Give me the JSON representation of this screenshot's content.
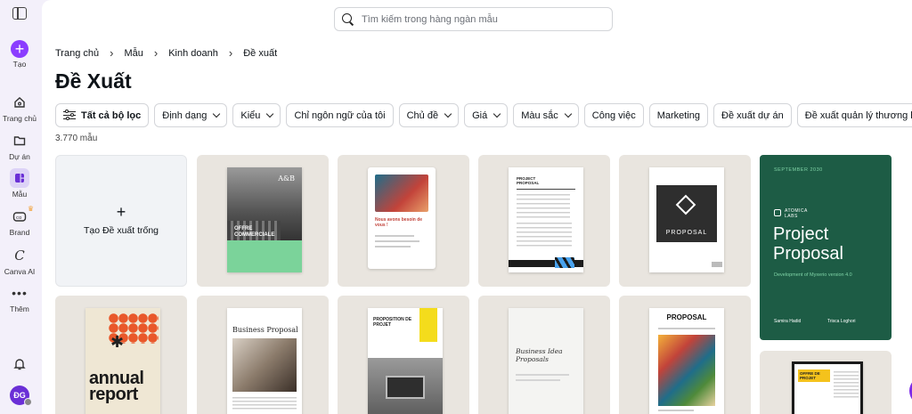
{
  "sidebar": {
    "create_label": "Tạo",
    "items": [
      {
        "label": "Trang chủ",
        "icon": "home-icon"
      },
      {
        "label": "Dự án",
        "icon": "folder-icon"
      },
      {
        "label": "Mẫu",
        "icon": "template-icon"
      },
      {
        "label": "Brand",
        "icon": "brand-icon"
      },
      {
        "label": "Canva AI",
        "icon": "canva-ai-icon"
      },
      {
        "label": "Thêm",
        "icon": "more-icon"
      }
    ],
    "avatar_initials": "ĐG"
  },
  "search": {
    "placeholder": "Tìm kiếm trong hàng ngàn mẫu"
  },
  "breadcrumb": [
    "Trang chủ",
    "Mẫu",
    "Kinh doanh",
    "Đề xuất"
  ],
  "page_title": "Đề Xuất",
  "filters": {
    "all_filters": "Tất cả bộ lọc",
    "dropdowns": [
      "Định dạng",
      "Kiểu"
    ],
    "language": "Chỉ ngôn ngữ của tôi",
    "dropdowns2": [
      "Chủ đề",
      "Giá",
      "Màu sắc"
    ],
    "tags": [
      "Công việc",
      "Marketing",
      "Đề xuất dự án",
      "Đề xuất quản lý thương hiệu"
    ]
  },
  "result_count": "3.770 mẫu",
  "blank_card_label": "Tạo Đề xuất trống",
  "templates": {
    "offre": {
      "brand": "A&B",
      "title": "OFFRE COMMERCIALE"
    },
    "nous": {
      "title": "Nous avons besoin de vous !"
    },
    "project_small": {
      "title": "PROJECT PROPOSAL"
    },
    "proposal_dark": {
      "title": "PROPOSAL"
    },
    "atomica": {
      "date": "SEPTEMBER 2030",
      "company": "ATOMICA LABS",
      "title": "Project Proposal",
      "subtitle": "Development of Myxerio version 4.0",
      "left_name": "Samira Hadid",
      "right_name": "Trisca Loghori"
    },
    "annual": {
      "title": "annual report"
    },
    "business": {
      "title": "Business Proposal"
    },
    "proposition": {
      "title": "PROPOSITION DE PROJET"
    },
    "ideas": {
      "title": "Business Idea Proposals"
    },
    "proposal_color": {
      "title": "PROPOSAL"
    },
    "offre_de_projet": {
      "title": "OFFRE DE PROJET"
    }
  },
  "help_label": "?",
  "colors": {
    "accent": "#8b3dff",
    "sidebar_bg": "#f3f0fa",
    "card_bg": "#e9e5df",
    "atomica_green": "#1d5c45"
  }
}
